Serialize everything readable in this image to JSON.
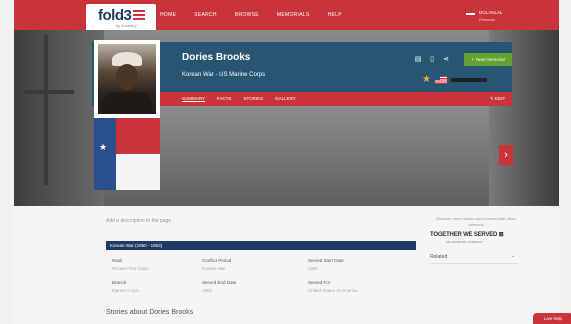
{
  "nav": {
    "logo": "fold3",
    "logo_sub": "by Ancestry",
    "links": [
      "HOME",
      "SEARCH",
      "BROWSE",
      "MEMORIALS",
      "HELP"
    ],
    "user_name": "DOLANLAL",
    "user_sub": "Personal"
  },
  "profile": {
    "name": "Dories Brooks",
    "war_line": "Korean War - US Marine Corps",
    "new_memorial_label": "New memorial",
    "tabs": [
      "SUMMARY",
      "FACTS",
      "STORIES",
      "GALLERY"
    ],
    "edit_label": "EDIT"
  },
  "summary": {
    "description_placeholder": "Add a description to the page",
    "service_header": "Korean War (1950 - 1953)",
    "fields": [
      {
        "key": "Rank",
        "value": "Private First Class"
      },
      {
        "key": "Conflict Period",
        "value": "Korean War"
      },
      {
        "key": "Served Start Date",
        "value": "1951"
      },
      {
        "key": "Branch",
        "value": "Marine Corps"
      },
      {
        "key": "Served End Date",
        "value": "1953"
      },
      {
        "key": "Served For",
        "value": "United States of America"
      }
    ],
    "stories_heading": "Stories about Dories Brooks"
  },
  "sidebar": {
    "note": "Discover more stories and connect with other veterans",
    "together_title": "TOGETHER WE SERVED",
    "together_sub": "AN ANCESTRY COMPANY",
    "related_label": "Related"
  },
  "help_label": "Live help",
  "colors": {
    "brand_red": "#c9343a",
    "navy": "#1f3b63",
    "card_blue": "#285571",
    "memorial_green": "#62a332"
  }
}
